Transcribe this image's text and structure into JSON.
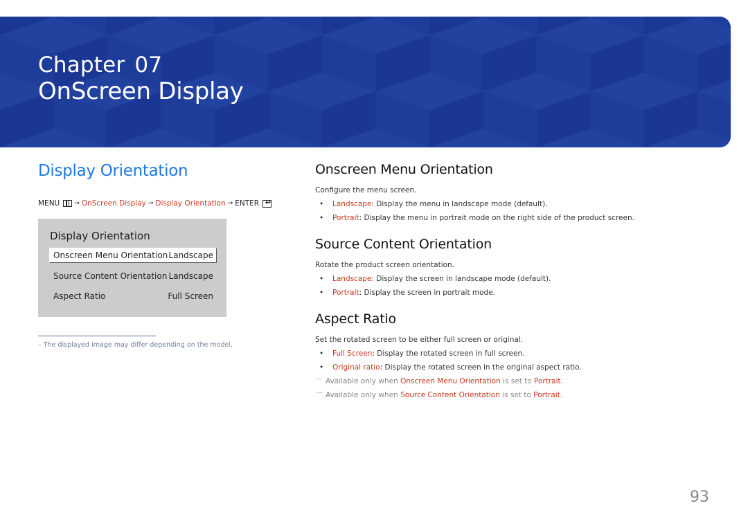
{
  "banner": {
    "chapter_label": "Chapter",
    "chapter_number": "07",
    "chapter_title": "OnScreen Display",
    "color": "#1f3c99"
  },
  "left": {
    "title": "Display Orientation",
    "breadcrumb": {
      "menu": "MENU",
      "menu_icon": "menu-grid-icon",
      "step1": "OnScreen Display",
      "step2": "Display Orientation",
      "enter": "ENTER",
      "enter_icon": "enter-return-icon",
      "arrow": "→"
    },
    "osd_menu": {
      "title": "Display Orientation",
      "rows": [
        {
          "label": "Onscreen Menu Orientation",
          "value": "Landscape",
          "selected": true
        },
        {
          "label": "Source Content Orientation",
          "value": "Landscape",
          "selected": false
        },
        {
          "label": "Aspect Ratio",
          "value": "Full Screen",
          "selected": false
        }
      ]
    },
    "footnote": "–  The displayed image may differ depending on the model."
  },
  "sections": [
    {
      "heading": "Onscreen Menu Orientation",
      "intro": "Configure the menu screen.",
      "bullets": [
        {
          "term": "Landscape",
          "text": ": Display the menu in landscape mode (default)."
        },
        {
          "term": "Portrait",
          "text": ": Display the menu in portrait mode on the right side of the product screen."
        }
      ]
    },
    {
      "heading": "Source Content Orientation",
      "intro": "Rotate the product screen orientation.",
      "bullets": [
        {
          "term": "Landscape",
          "text": ": Display the screen in landscape mode (default)."
        },
        {
          "term": "Portrait",
          "text": ": Display the screen in portrait mode."
        }
      ]
    },
    {
      "heading": "Aspect Ratio",
      "intro": "Set the rotated screen to be either full screen or original.",
      "bullets": [
        {
          "term": "Full Screen",
          "text": ": Display the rotated screen in full screen."
        },
        {
          "term": "Original ratio",
          "text": ": Display the rotated screen in the original aspect ratio."
        }
      ],
      "notes": [
        {
          "pre": "Available only when ",
          "link": "Onscreen Menu Orientation",
          "mid": " is set to ",
          "value": "Portrait",
          "post": "."
        },
        {
          "pre": "Available only when ",
          "link": "Source Content Orientation",
          "mid": " is set to ",
          "value": "Portrait",
          "post": "."
        }
      ]
    }
  ],
  "bullet_char": "•",
  "note_char": "—",
  "page_number": "93",
  "colors": {
    "accent_blue": "#1e7ae6",
    "link_red": "#c8381d",
    "osd_gray": "#cccccc"
  }
}
